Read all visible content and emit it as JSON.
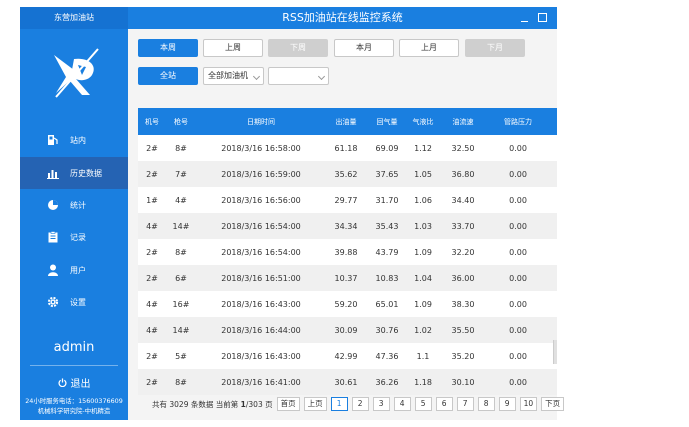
{
  "sidebar": {
    "station_name": "东营加油站",
    "items": [
      {
        "label": "站内",
        "icon": "fuel-pump-icon"
      },
      {
        "label": "历史数据",
        "icon": "bar-chart-icon"
      },
      {
        "label": "统计",
        "icon": "pie-chart-icon"
      },
      {
        "label": "记录",
        "icon": "clipboard-icon"
      },
      {
        "label": "用户",
        "icon": "user-icon"
      },
      {
        "label": "设置",
        "icon": "gear-icon"
      }
    ],
    "active_index": 1,
    "username": "admin",
    "logout_label": "退出",
    "hotline": "24小时服务电话：15600376609",
    "company": "机械科学研究院-中机精造"
  },
  "header": {
    "title": "RSS加油站在线监控系统"
  },
  "filters": {
    "this_week": "本周",
    "last_week": "上周",
    "next_week": "下周",
    "this_month": "本月",
    "last_month": "上月",
    "next_month": "下月",
    "all_station": "全站",
    "machine_select": "全部加油机",
    "second_select": ""
  },
  "table": {
    "columns": [
      "机号",
      "枪号",
      "日期时间",
      "出油量",
      "回气量",
      "气液比",
      "油流速",
      "管路压力"
    ],
    "rows": [
      [
        "2#",
        "8#",
        "2018/3/16 16:58:00",
        "61.18",
        "69.09",
        "1.12",
        "32.50",
        "0.00"
      ],
      [
        "2#",
        "7#",
        "2018/3/16 16:59:00",
        "35.62",
        "37.65",
        "1.05",
        "36.80",
        "0.00"
      ],
      [
        "1#",
        "4#",
        "2018/3/16 16:56:00",
        "29.77",
        "31.70",
        "1.06",
        "34.40",
        "0.00"
      ],
      [
        "4#",
        "14#",
        "2018/3/16 16:54:00",
        "34.34",
        "35.43",
        "1.03",
        "33.70",
        "0.00"
      ],
      [
        "2#",
        "8#",
        "2018/3/16 16:54:00",
        "39.88",
        "43.79",
        "1.09",
        "32.20",
        "0.00"
      ],
      [
        "2#",
        "6#",
        "2018/3/16 16:51:00",
        "10.37",
        "10.83",
        "1.04",
        "36.00",
        "0.00"
      ],
      [
        "4#",
        "16#",
        "2018/3/16 16:43:00",
        "59.20",
        "65.01",
        "1.09",
        "38.30",
        "0.00"
      ],
      [
        "4#",
        "14#",
        "2018/3/16 16:44:00",
        "30.09",
        "30.76",
        "1.02",
        "35.50",
        "0.00"
      ],
      [
        "2#",
        "5#",
        "2018/3/16 16:43:00",
        "42.99",
        "47.36",
        "1.1",
        "35.20",
        "0.00"
      ],
      [
        "2#",
        "8#",
        "2018/3/16 16:41:00",
        "30.61",
        "36.26",
        "1.18",
        "30.10",
        "0.00"
      ]
    ]
  },
  "pagination": {
    "total_prefix": "共有",
    "total": "3029",
    "total_suffix": "条数据 当前第",
    "current": "1",
    "sep": "/303 页",
    "first": "首页",
    "prev": "上页",
    "pages": [
      "1",
      "2",
      "3",
      "4",
      "5",
      "6",
      "7",
      "8",
      "9",
      "10"
    ],
    "next": "下页"
  },
  "colors": {
    "primary": "#1a7fe0",
    "active_nav": "#2563b3",
    "disabled": "#cfcfcf"
  }
}
